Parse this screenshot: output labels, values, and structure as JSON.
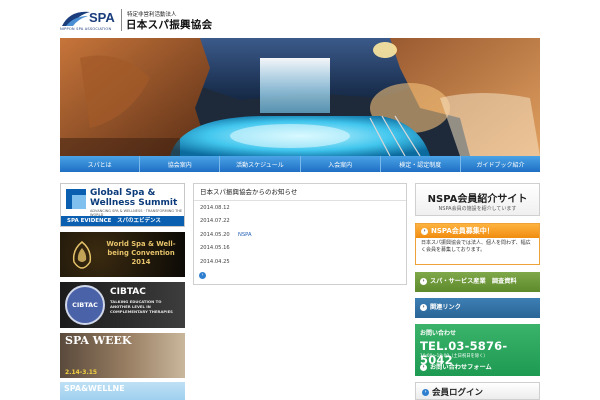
{
  "header": {
    "logo_text": "SPA",
    "logo_assoc": "NIPPON SPA ASSOCIATION",
    "org_sub": "特定非営利活動法人",
    "org_title": "日本スパ振興協会"
  },
  "nav": {
    "items": [
      "スパとは",
      "協会案内",
      "活動スケジュール",
      "入会案内",
      "検定・認定制度",
      "ガイドブック紹介"
    ]
  },
  "banners": {
    "summit": {
      "line1": "Global Spa &",
      "line2": "Wellness Summit",
      "tagline": "ADVANCING SPA & WELLNESS · TRANSFORMING THE WORLD",
      "bar": "SPA EVIDENCE　スパのエビデンス"
    },
    "convention": {
      "text": "World Spa & Well-being Convention 2014"
    },
    "cibtac": {
      "badge": "CIBTAC",
      "title": "CIBTAC",
      "sub": "TALKING EDUCATION TO ANOTHER LEVEL IN COMPLEMENTARY THERAPIES"
    },
    "spaweek": {
      "title": "SPA WEEK",
      "dates": "2.14-3.15"
    },
    "wellness": {
      "title": "SPA&WELLNE"
    }
  },
  "news": {
    "heading": "日本スパ振興協会からのお知らせ",
    "items": [
      {
        "date": "2014.08.12",
        "text": ""
      },
      {
        "date": "2014.07.22",
        "text": ""
      },
      {
        "date": "2014.05.20",
        "text": "NSPA"
      },
      {
        "date": "2014.05.16",
        "text": ""
      },
      {
        "date": "2014.04.25",
        "text": ""
      }
    ],
    "more_icon": "›"
  },
  "sidebar": {
    "member_site": {
      "title": "NSPA会員紹介サイト",
      "sub": "NSPA会員の施設を紹介しています"
    },
    "recruit": {
      "title": "NSPA会員募集中！",
      "body": "日本スパ振興協会では法人、個人を問わず、幅広く会員を募集しております。"
    },
    "survey": "スパ・サービス産業　調査資料",
    "links": "関連リンク",
    "contact": {
      "label": "お問い合わせ",
      "tel": "TEL.03-5876-5042",
      "hours": "10:00〜18:00（土日祝日を除く）",
      "form": "お問い合わせフォーム"
    },
    "login": "会員ログイン"
  },
  "colors": {
    "nav_blue": "#1f6fc4",
    "contact_green": "#1e9a52",
    "recruit_orange": "#f08c10"
  }
}
